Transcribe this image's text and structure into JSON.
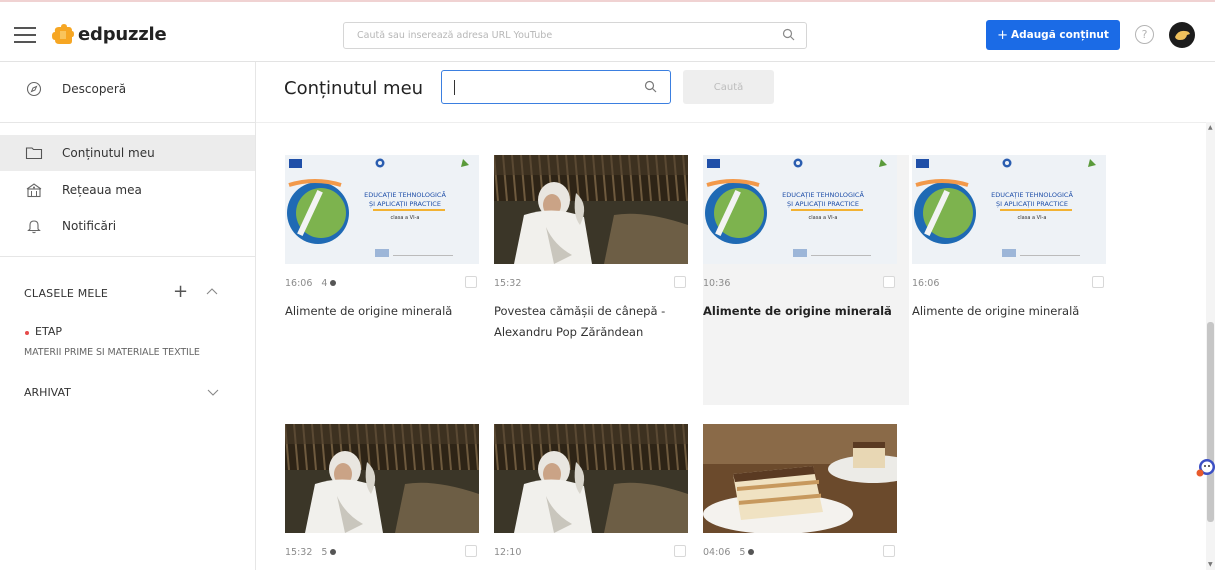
{
  "app": {
    "name": "edpuzzle"
  },
  "header": {
    "search_placeholder": "Caută sau inserează adresa URL YouTube",
    "add_button": "Adaugă conținut",
    "help_symbol": "?"
  },
  "sidebar": {
    "discover": "Descoperă",
    "my_content": "Conținutul meu",
    "my_network": "Rețeaua mea",
    "notifications": "Notificări",
    "classes_title": "CLASELE MELE",
    "class": {
      "name": "ETAP",
      "subtitle": "MATERII PRIME SI MATERIALE TEXTILE"
    },
    "archived": "ARHIVAT"
  },
  "main": {
    "title": "Conținutul meu",
    "search_value": "",
    "search_button": "Caută"
  },
  "videos": [
    {
      "duration": "16:06",
      "questions": "4",
      "title": "Alimente de origine minerală",
      "thumb": "poster"
    },
    {
      "duration": "15:32",
      "questions": "",
      "title": "Povestea cămășii de cânepă - Alexandru Pop Zărăndean",
      "thumb": "photo-woman"
    },
    {
      "duration": "10:36",
      "questions": "",
      "title": "Alimente de origine minerală",
      "thumb": "poster"
    },
    {
      "duration": "16:06",
      "questions": "",
      "title": "Alimente de origine minerală",
      "thumb": "poster"
    },
    {
      "duration": "15:32",
      "questions": "5",
      "title": "",
      "thumb": "photo-woman"
    },
    {
      "duration": "12:10",
      "questions": "",
      "title": "",
      "thumb": "photo-woman"
    },
    {
      "duration": "04:06",
      "questions": "5",
      "title": "",
      "thumb": "photo-cake"
    }
  ],
  "poster_text": {
    "line1": "EDUCAȚIE TEHNOLOGICĂ",
    "line2": "ȘI APLICAȚII PRACTICE",
    "line3": "clasa a VI-a"
  },
  "colors": {
    "accent": "#1b6be6",
    "class_bullet": "#e64b4b",
    "active_bg": "#ececec"
  }
}
